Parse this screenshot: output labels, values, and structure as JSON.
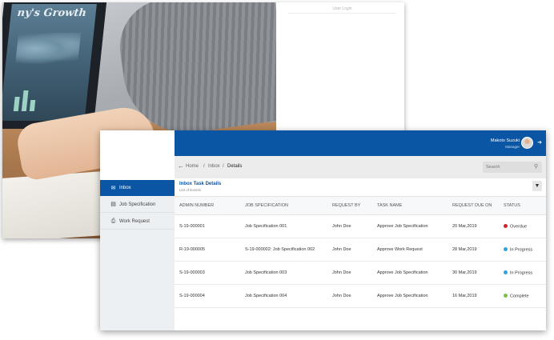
{
  "login_screen": {
    "title": "User Login",
    "hero_tablet_text": "ny's Growth"
  },
  "header": {
    "user_name": "Makoto Suzuki",
    "user_role": "Manager"
  },
  "sidebar": {
    "items": [
      {
        "label": "Inbox",
        "icon": "inbox-icon",
        "active": true
      },
      {
        "label": "Job Specification",
        "icon": "document-icon",
        "active": false
      },
      {
        "label": "Work Request",
        "icon": "printer-icon",
        "active": false
      }
    ]
  },
  "breadcrumb": {
    "items": [
      "Home",
      "Inbox",
      "Details"
    ],
    "separator": "/"
  },
  "search": {
    "placeholder": "Search"
  },
  "panel": {
    "title": "Inbox Task Details",
    "subtitle": "List of Events"
  },
  "table": {
    "columns": [
      "ADMIN NUMBER",
      "JOB SPECIFICATION",
      "REQUEST BY",
      "TASK NAME",
      "REQUEST DUE ON",
      "STATUS"
    ],
    "rows": [
      {
        "admin_number": "S-19-000001",
        "job_specification": "Job Specification 001",
        "request_by": "John Doe",
        "task_name": "Approve Job Specification",
        "due_on": "20 Mar,2019",
        "status": "Overdue",
        "status_color": "#d0242b"
      },
      {
        "admin_number": "R-19-000005",
        "job_specification": "S-19-000002: Job Specification 002",
        "request_by": "John Doe",
        "task_name": "Approve Work Request",
        "due_on": "28 Mar,2019",
        "status": "In Progress",
        "status_color": "#2ea3dc"
      },
      {
        "admin_number": "S-19-000003",
        "job_specification": "Job Specification 003",
        "request_by": "John Doe",
        "task_name": "Approve Job Specification",
        "due_on": "30 Mar,2019",
        "status": "In Progress",
        "status_color": "#2ea3dc"
      },
      {
        "admin_number": "S-19-000004",
        "job_specification": "Job Specification 004",
        "request_by": "John Doe",
        "task_name": "Approve Job Specification",
        "due_on": "16 Mar,2019",
        "status": "Complete",
        "status_color": "#7ac143"
      }
    ]
  },
  "colors": {
    "primary": "#0a56a5",
    "sidebar_bg": "#edf0f3"
  }
}
